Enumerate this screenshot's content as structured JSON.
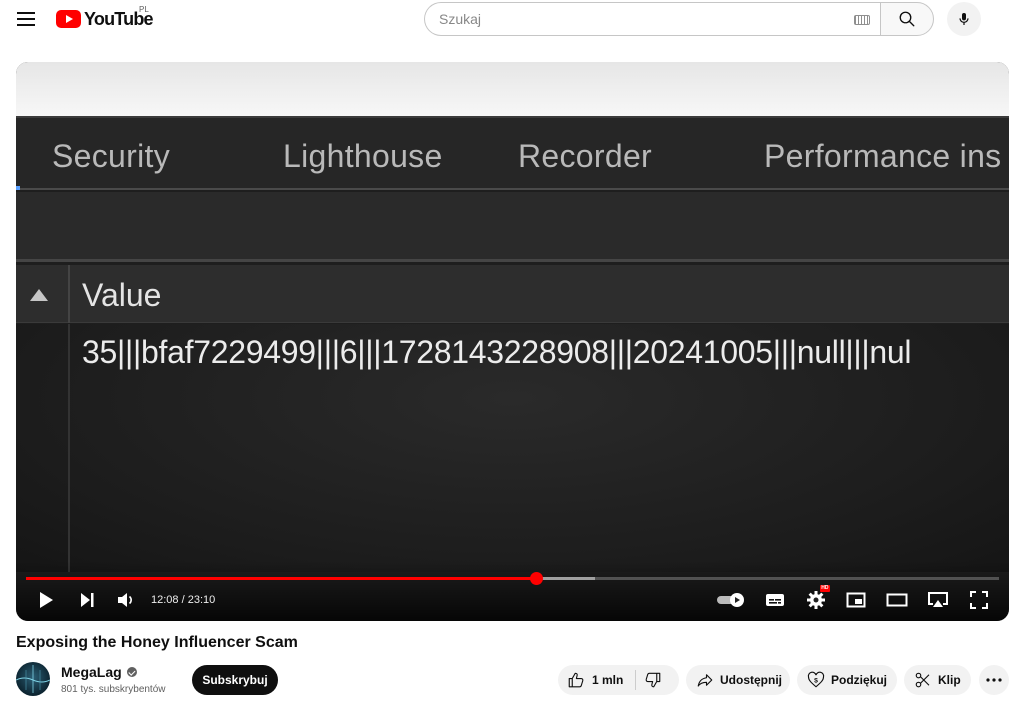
{
  "masthead": {
    "logo_text": "YouTube",
    "country_code": "PL",
    "search_placeholder": "Szukaj",
    "icons": [
      "menu-icon",
      "keyboard-icon",
      "search-icon",
      "mic-icon"
    ]
  },
  "video_frame": {
    "tabs": [
      "Security",
      "Lighthouse",
      "Recorder",
      "Performance ins"
    ],
    "column_header": "Value",
    "cell_value": "35|||bfaf7229499|||6|||1728143228908|||20241005|||null|||nul"
  },
  "player": {
    "current_time": "12:08",
    "duration": "23:10",
    "time_separator": " / ",
    "played_fraction": 0.524,
    "buffered_fraction": 0.585,
    "progress_color": "#ff0000",
    "settings_badge": "HD",
    "icons": [
      "play-icon",
      "next-icon",
      "volume-icon",
      "autoplay-toggle-icon",
      "subtitles-icon",
      "settings-icon",
      "miniplayer-icon",
      "theater-icon",
      "cast-icon",
      "fullscreen-icon"
    ]
  },
  "video": {
    "title": "Exposing the Honey Influencer Scam"
  },
  "channel": {
    "name": "MegaLag",
    "subscribers": "801 tys. subskrybentów",
    "subscribe_label": "Subskrybuj"
  },
  "actions": {
    "likes": "1 mln",
    "share_label": "Udostępnij",
    "thanks_label": "Podziękuj",
    "clip_label": "Klip"
  }
}
